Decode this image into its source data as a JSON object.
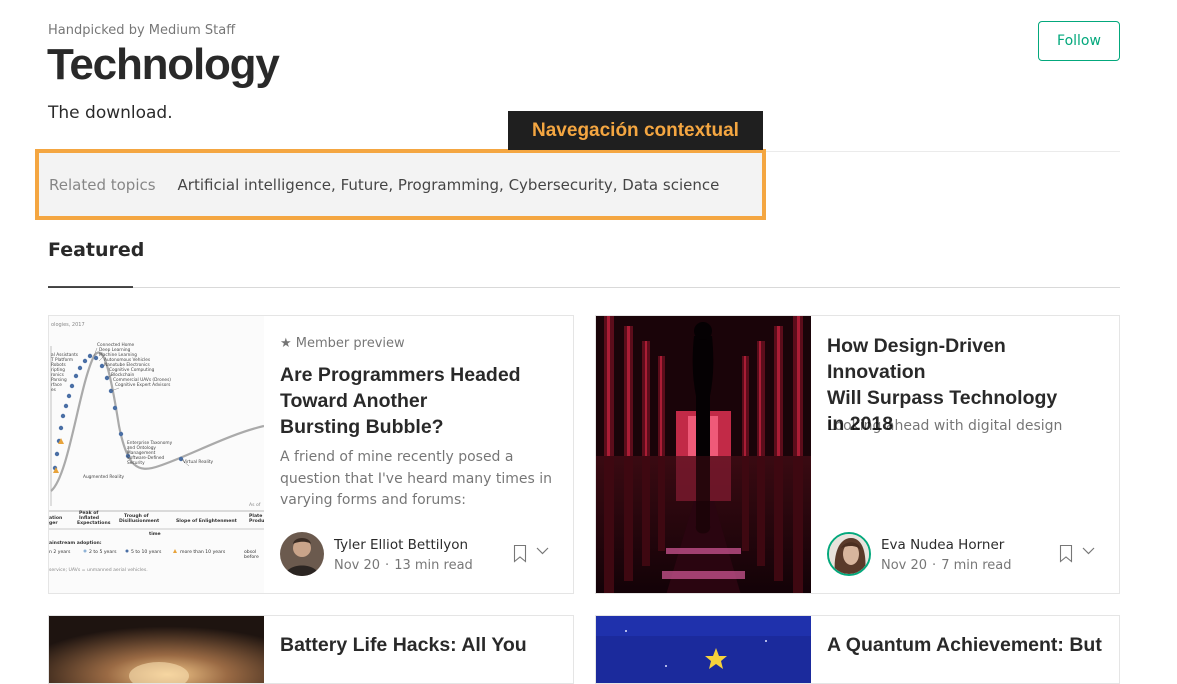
{
  "header": {
    "eyebrow": "Handpicked by Medium Staff",
    "title": "Technology",
    "tagline": "The download.",
    "follow_label": "Follow"
  },
  "annotation": {
    "label": "Navegación contextual",
    "color": "#f4a641"
  },
  "related": {
    "label": "Related topics",
    "topics": [
      "Artificial intelligence",
      "Future",
      "Programming",
      "Cybersecurity",
      "Data science"
    ]
  },
  "featured_label": "Featured",
  "colors": {
    "accent": "#03a87c",
    "annotation": "#f4a641"
  },
  "articles": [
    {
      "member_preview": "★ Member preview",
      "title_lines": [
        "Are Programmers Headed",
        "Toward Another",
        "Bursting Bubble?"
      ],
      "subtitle_lines": [
        "A friend of mine recently posed a",
        "question that I've heard many times in",
        "varying forms and forums:"
      ],
      "author": "Tyler Elliot Bettilyon",
      "date": "Nov 20",
      "read_time": "13 min read",
      "image": "hype-cycle-chart",
      "avatar": "author-photo"
    },
    {
      "title_lines": [
        "How Design-Driven Innovation",
        "Will Surpass Technology",
        "in 2018"
      ],
      "subtitle_lines": [
        "Looking ahead with digital design"
      ],
      "author": "Eva Nudea Horner",
      "date": "Nov 20",
      "read_time": "7 min read",
      "image": "red-corridor-photo",
      "avatar": "author-photo"
    },
    {
      "title_lines": [
        "Battery Life Hacks: All You"
      ],
      "image": "warm-photo"
    },
    {
      "title_lines": [
        "A Quantum Achievement: But"
      ],
      "image": "blue-starfield"
    }
  ]
}
